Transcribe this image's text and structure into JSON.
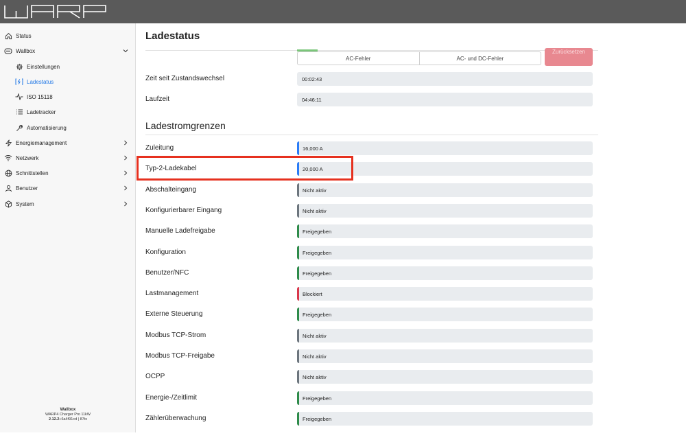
{
  "app": {
    "logo_text": "WARP"
  },
  "sidebar": {
    "items": [
      {
        "label": "Status",
        "icon": "home-icon",
        "expandable": false
      },
      {
        "label": "Wallbox",
        "icon": "wallbox-icon",
        "expandable": true,
        "expanded": true
      },
      {
        "label": "Einstellungen",
        "icon": "gear-icon",
        "sub": true
      },
      {
        "label": "Ladestatus",
        "icon": "charging-icon",
        "sub": true,
        "active": true
      },
      {
        "label": "ISO 15118",
        "icon": "pulse-icon",
        "sub": true
      },
      {
        "label": "Ladetracker",
        "icon": "list-icon",
        "sub": true
      },
      {
        "label": "Automatisierung",
        "icon": "wrench-icon",
        "sub": true
      },
      {
        "label": "Energiemanagement",
        "icon": "bolt-icon",
        "expandable": true
      },
      {
        "label": "Netzwerk",
        "icon": "wifi-icon",
        "expandable": true
      },
      {
        "label": "Schnittstellen",
        "icon": "globe-icon",
        "expandable": true
      },
      {
        "label": "Benutzer",
        "icon": "user-icon",
        "expandable": true
      },
      {
        "label": "System",
        "icon": "cube-icon",
        "expandable": true
      }
    ],
    "footer": {
      "title": "Wallbox",
      "device": "WARP4 Charger Pro 11kW",
      "version_bold": "2.12.2",
      "version_rest": "+6a4f91cd | 87tx"
    }
  },
  "main": {
    "title": "Ladestatus",
    "error_buttons": [
      "AC-Fehler",
      "AC- und DC-Fehler"
    ],
    "reset_label": "Zurücksetzen",
    "info_rows": [
      {
        "label": "Zeit seit Zustandswechsel",
        "value": "00:02:43"
      },
      {
        "label": "Laufzeit",
        "value": "04:46:11"
      }
    ],
    "limits_title": "Ladestromgrenzen",
    "limits": [
      {
        "label": "Zuleitung",
        "value": "16,000 A",
        "status_color": "#2b7cf6"
      },
      {
        "label": "Typ-2-Ladekabel",
        "value": "20,000 A",
        "status_color": "#2b7cf6"
      },
      {
        "label": "Abschalteingang",
        "value": "Nicht aktiv",
        "status_color": "#6c757d"
      },
      {
        "label": "Konfigurierbarer Eingang",
        "value": "Nicht aktiv",
        "status_color": "#6c757d"
      },
      {
        "label": "Manuelle Ladefreigabe",
        "value": "Freigegeben",
        "status_color": "#2e8b4a"
      },
      {
        "label": "Konfiguration",
        "value": "Freigegeben",
        "status_color": "#2e8b4a"
      },
      {
        "label": "Benutzer/NFC",
        "value": "Freigegeben",
        "status_color": "#2e8b4a"
      },
      {
        "label": "Lastmanagement",
        "value": "Blockiert",
        "status_color": "#d9374b"
      },
      {
        "label": "Externe Steuerung",
        "value": "Freigegeben",
        "status_color": "#2e8b4a"
      },
      {
        "label": "Modbus TCP-Strom",
        "value": "Nicht aktiv",
        "status_color": "#6c757d"
      },
      {
        "label": "Modbus TCP-Freigabe",
        "value": "Nicht aktiv",
        "status_color": "#6c757d"
      },
      {
        "label": "OCPP",
        "value": "Nicht aktiv",
        "status_color": "#6c757d"
      },
      {
        "label": "Energie-/Zeitlimit",
        "value": "Freigegeben",
        "status_color": "#2e8b4a"
      },
      {
        "label": "Zählerüberwachung",
        "value": "Freigegeben",
        "status_color": "#2e8b4a"
      }
    ]
  },
  "colors": {
    "accent": "#1f77e6",
    "highlight_box": "#e6311f",
    "reset_button": "#e88890"
  }
}
